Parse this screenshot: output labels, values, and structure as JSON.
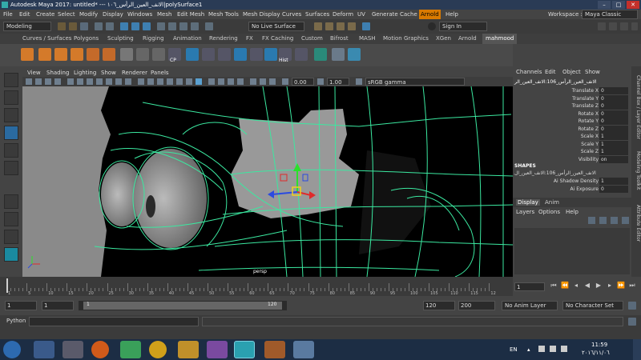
{
  "titlebar": {
    "title": "Autodesk Maya 2017: untitled*   ---   الانف_العين_الرأس_١٠٦|polySurface1",
    "minimize": "–",
    "maximize": "□",
    "close": "✕"
  },
  "menubar": {
    "items": [
      "File",
      "Edit",
      "Create",
      "Select",
      "Modify",
      "Display",
      "Windows",
      "Mesh",
      "Edit Mesh",
      "Mesh Tools",
      "Mesh Display",
      "Curves",
      "Surfaces",
      "Deform",
      "UV",
      "Generate",
      "Cache",
      "Arnold",
      "Help"
    ],
    "workspace_label": "Workspace :",
    "workspace_value": "Maya Classic"
  },
  "statusline": {
    "mode": "Modeling",
    "live_surface": "No Live Surface",
    "sign_in": "Sign In"
  },
  "shelf_tabs": [
    "Curves / Surfaces",
    "Polygons",
    "Sculpting",
    "Rigging",
    "Animation",
    "Rendering",
    "FX",
    "FX Caching",
    "Custom",
    "Bifrost",
    "MASH",
    "Motion Graphics",
    "XGen",
    "Arnold",
    "mahmood"
  ],
  "shelf": {
    "cp_label": "CP",
    "hist_label": "Hist"
  },
  "viewport_menu": [
    "View",
    "Shading",
    "Lighting",
    "Show",
    "Renderer",
    "Panels"
  ],
  "viewport_toolbar": {
    "exposure": "0.00",
    "gamma": "1.00",
    "color_space": "sRGB gamma"
  },
  "viewport": {
    "camera_label": "persp"
  },
  "channelbox": {
    "menu": [
      "Channels",
      "Edit",
      "Object",
      "Show"
    ],
    "object_name": "الانف_العين_الرأس_106:الانف_العين_الر",
    "attributes": [
      {
        "name": "Translate X",
        "value": "0"
      },
      {
        "name": "Translate Y",
        "value": "0"
      },
      {
        "name": "Translate Z",
        "value": "0"
      },
      {
        "name": "Rotate X",
        "value": "0"
      },
      {
        "name": "Rotate Y",
        "value": "0"
      },
      {
        "name": "Rotate Z",
        "value": "0"
      },
      {
        "name": "Scale X",
        "value": "1"
      },
      {
        "name": "Scale Y",
        "value": "1"
      },
      {
        "name": "Scale Z",
        "value": "1"
      },
      {
        "name": "Visibility",
        "value": "on"
      }
    ],
    "shapes_label": "SHAPES",
    "shape_name": "الانف_العين_الرأس_106:الانف_العين_ال",
    "shape_attrs": [
      {
        "name": "Ai Shadow Density",
        "value": "1"
      },
      {
        "name": "Ai Exposure",
        "value": "0"
      }
    ],
    "layer_tabs": [
      "Display",
      "Anim"
    ],
    "layer_menu": [
      "Layers",
      "Options",
      "Help"
    ]
  },
  "side_tabs": [
    "Channel Box / Layer Editor",
    "Modeling Toolkit",
    "Attribute Editor"
  ],
  "timeline": {
    "ticks": [
      "1",
      "5",
      "10",
      "15",
      "20",
      "25",
      "30",
      "35",
      "40",
      "45",
      "50",
      "55",
      "60",
      "65",
      "70",
      "75",
      "80",
      "85",
      "90",
      "95",
      "100",
      "105",
      "110",
      "115",
      "12"
    ],
    "current_frame": "1"
  },
  "range": {
    "start": "1",
    "anim_start": "1",
    "slider_start": "1",
    "slider_end": "120",
    "anim_end": "120",
    "end": "200",
    "anim_layer": "No Anim Layer",
    "character_set": "No Character Set"
  },
  "command_line": {
    "label": "Python"
  },
  "taskbar": {
    "language": "EN",
    "time": "11:59",
    "date": "٢٠١٦/١١/٠٦"
  }
}
